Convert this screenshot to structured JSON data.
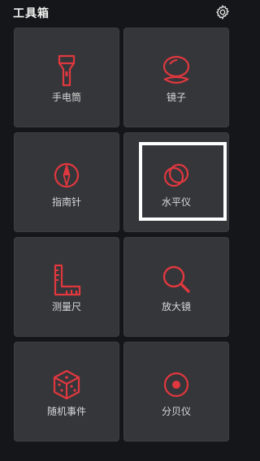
{
  "header": {
    "title": "工具箱",
    "settings_icon": "gear-icon"
  },
  "tools": [
    {
      "label": "手电筒",
      "icon": "flashlight-icon"
    },
    {
      "label": "镜子",
      "icon": "mirror-icon"
    },
    {
      "label": "指南针",
      "icon": "compass-icon"
    },
    {
      "label": "水平仪",
      "icon": "level-icon"
    },
    {
      "label": "测量尺",
      "icon": "ruler-icon"
    },
    {
      "label": "放大镜",
      "icon": "magnifier-icon"
    },
    {
      "label": "随机事件",
      "icon": "dice-icon"
    },
    {
      "label": "分贝仪",
      "icon": "decibel-meter-icon"
    }
  ],
  "colors": {
    "accent": "#e0383e",
    "tile": "#35363a",
    "background": "#151619"
  }
}
